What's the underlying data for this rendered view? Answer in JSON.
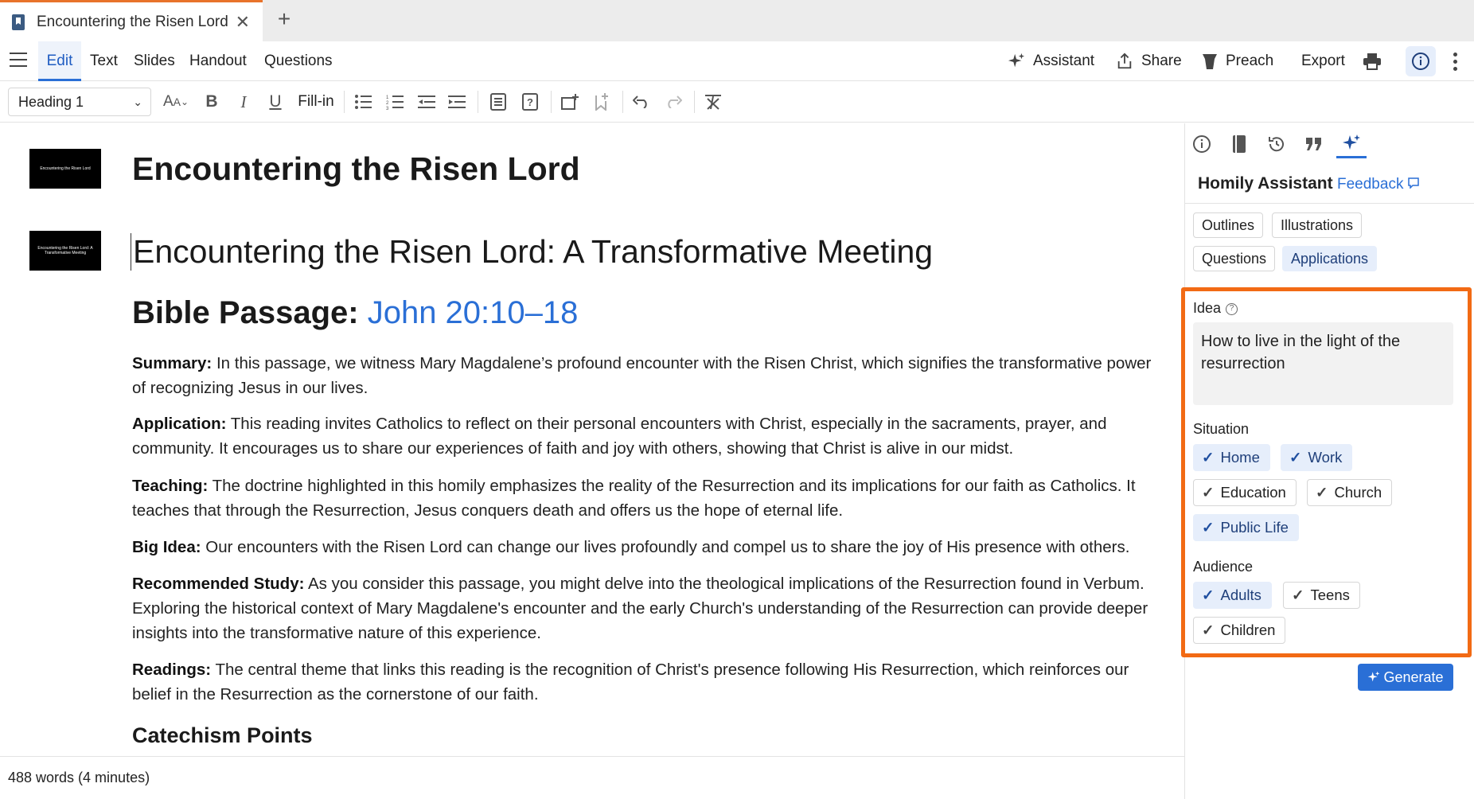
{
  "tab": {
    "title": "Encountering the Risen Lord",
    "close": "✕",
    "new": "+"
  },
  "menu": {
    "edit": "Edit",
    "text": "Text",
    "slides": "Slides",
    "handout": "Handout",
    "questions": "Questions"
  },
  "right_tools": {
    "assistant": "Assistant",
    "share": "Share",
    "preach": "Preach",
    "export": "Export"
  },
  "format": {
    "style": "Heading 1",
    "fillin": "Fill-in"
  },
  "doc": {
    "thumb1_text": "Encountering the Risen Lord",
    "thumb2_text": "Encountering the Risen Lord: A Transformative Meeting",
    "title": "Encountering the Risen Lord",
    "subtitle": "Encountering the Risen Lord: A Transformative Meeting",
    "passage_label": "Bible Passage:",
    "passage_ref": "John 20:10–18",
    "sections": [
      {
        "label": "Summary:",
        "text": "In this passage, we witness Mary Magdalene’s profound encounter with the Risen Christ, which signifies the transformative power of recognizing Jesus in our lives."
      },
      {
        "label": "Application:",
        "text": "This reading invites Catholics to reflect on their personal encounters with Christ, especially in the sacraments, prayer, and community. It encourages us to share our experiences of faith and joy with others, showing that Christ is alive in our midst."
      },
      {
        "label": "Teaching:",
        "text": "The doctrine highlighted in this homily emphasizes the reality of the Resurrection and its implications for our faith as Catholics. It teaches that through the Resurrection, Jesus conquers death and offers us the hope of eternal life."
      },
      {
        "label": "Big Idea:",
        "text": "Our encounters with the Risen Lord can change our lives profoundly and compel us to share the joy of His presence with others."
      },
      {
        "label": "Recommended Study:",
        "text": "As you consider this passage, you might delve into the theological implications of the Resurrection found in Verbum. Exploring the historical context of Mary Magdalene's encounter and the early Church's understanding of the Resurrection can provide deeper insights into the transformative nature of this experience."
      },
      {
        "label": "Readings:",
        "text": "The central theme that links this reading is the recognition of Christ's presence following His Resurrection, which reinforces our belief in the Resurrection as the cornerstone of our faith."
      }
    ],
    "catechism_heading": "Catechism Points"
  },
  "status": {
    "words": "488 words (4 minutes)"
  },
  "panel": {
    "title": "Homily Assistant",
    "feedback": "Feedback",
    "modes": [
      "Outlines",
      "Illustrations",
      "Questions",
      "Applications"
    ],
    "selected_mode": "Applications",
    "idea_label": "Idea",
    "idea_value": "How to live in the light of the resurrection",
    "situation_label": "Situation",
    "situations": [
      {
        "label": "Home",
        "on": true
      },
      {
        "label": "Work",
        "on": true
      },
      {
        "label": "Education",
        "on": false
      },
      {
        "label": "Church",
        "on": false
      },
      {
        "label": "Public Life",
        "on": true
      }
    ],
    "audience_label": "Audience",
    "audiences": [
      {
        "label": "Adults",
        "on": true
      },
      {
        "label": "Teens",
        "on": false
      },
      {
        "label": "Children",
        "on": false
      }
    ],
    "generate": "Generate"
  },
  "colors": {
    "accent": "#2a6fd6",
    "highlight_box": "#f26a14",
    "tab_accent": "#e8732b"
  }
}
